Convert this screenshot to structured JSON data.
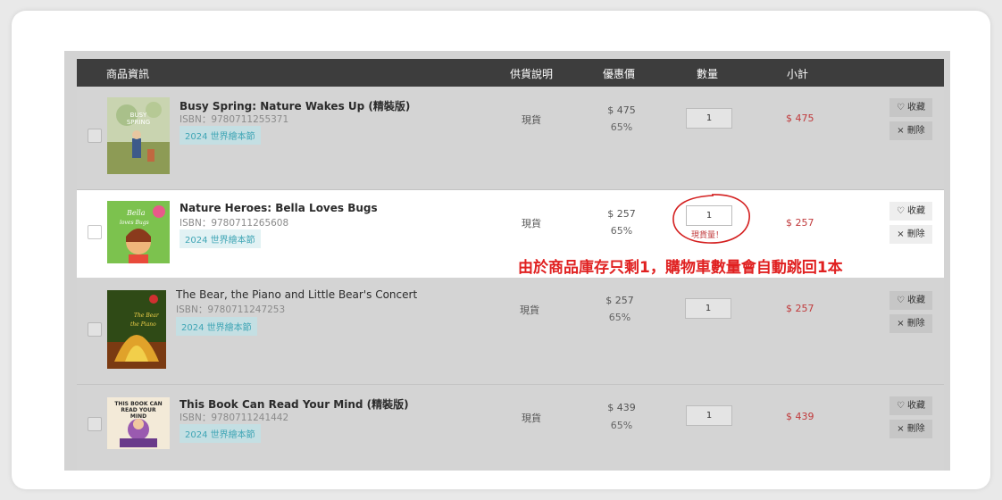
{
  "header": {
    "col_info": "商品資訊",
    "col_stock": "供貨說明",
    "col_price": "優惠價",
    "col_qty": "數量",
    "col_subtotal": "小計"
  },
  "items": [
    {
      "title": "Busy Spring: Nature Wakes Up (精裝版)",
      "isbn": "ISBN：9780711255371",
      "tag": "2024 世界繪本節",
      "stock": "現貨",
      "price": "$ 475",
      "discount": "65%",
      "qty": "1",
      "subtotal": "$ 475",
      "cover_text": "BUSY SPRING"
    },
    {
      "title": "Nature Heroes: Bella Loves Bugs",
      "isbn": "ISBN：9780711265608",
      "tag": "2024 世界繪本節",
      "stock": "現貨",
      "price": "$ 257",
      "discount": "65%",
      "qty": "1",
      "subtotal": "$ 257",
      "cover_text": "Bella loves Bugs",
      "stock_warning": "現貨量！"
    },
    {
      "title": "The Bear, the Piano and Little Bear's Concert",
      "isbn": "ISBN：9780711247253",
      "tag": "2024 世界繪本節",
      "stock": "現貨",
      "price": "$ 257",
      "discount": "65%",
      "qty": "1",
      "subtotal": "$ 257",
      "cover_text": "The Bear the Piano"
    },
    {
      "title": "This Book Can Read Your Mind (精裝版)",
      "isbn": "ISBN：9780711241442",
      "tag": "2024 世界繪本節",
      "stock": "現貨",
      "price": "$ 439",
      "discount": "65%",
      "qty": "1",
      "subtotal": "$ 439",
      "cover_text": "THIS BOOK CAN READ YOUR MIND"
    }
  ],
  "actions": {
    "favorite": "收藏",
    "delete": "刪除"
  },
  "annotation": "由於商品庫存只剩1，購物車數量會自動跳回1本",
  "colors": {
    "header_bg": "#3d3d3d",
    "subtotal": "#c0393b",
    "annotation": "#e02020",
    "tag": "#3fa5b5"
  }
}
